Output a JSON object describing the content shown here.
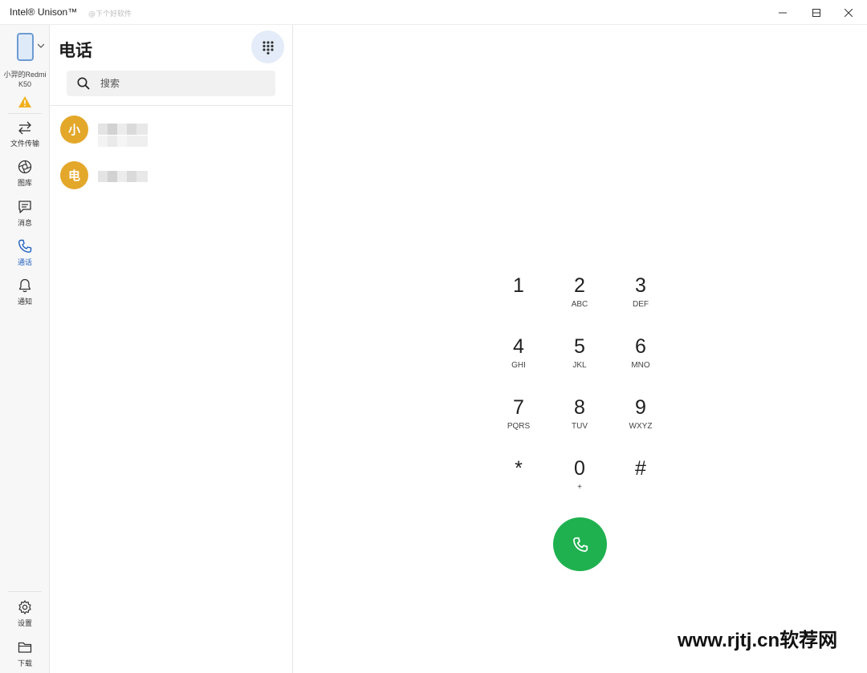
{
  "window": {
    "title": "Intel® Unison™",
    "top_watermark": "@下个好软件",
    "controls": [
      "minimize-icon",
      "maximize-icon",
      "close-icon"
    ]
  },
  "device": {
    "name_line1": "小羿的Redmi",
    "name_line2": "K50",
    "status_icon": "warning-icon"
  },
  "rail": {
    "items": [
      {
        "label": "文件传输",
        "icon": "transfer-icon"
      },
      {
        "label": "图库",
        "icon": "gallery-icon"
      },
      {
        "label": "消息",
        "icon": "message-icon"
      },
      {
        "label": "通话",
        "icon": "phone-icon",
        "active": true
      },
      {
        "label": "通知",
        "icon": "bell-icon"
      }
    ],
    "bottom": [
      {
        "label": "设置",
        "icon": "gear-icon"
      },
      {
        "label": "下载",
        "icon": "folder-icon"
      }
    ]
  },
  "panel": {
    "title": "电话",
    "search_placeholder": "搜索",
    "contacts": [
      {
        "initial": "小"
      },
      {
        "initial": "电"
      }
    ]
  },
  "dialer": {
    "keys": [
      {
        "num": "1",
        "letters": ""
      },
      {
        "num": "2",
        "letters": "ABC"
      },
      {
        "num": "3",
        "letters": "DEF"
      },
      {
        "num": "4",
        "letters": "GHI"
      },
      {
        "num": "5",
        "letters": "JKL"
      },
      {
        "num": "6",
        "letters": "MNO"
      },
      {
        "num": "7",
        "letters": "PQRS"
      },
      {
        "num": "8",
        "letters": "TUV"
      },
      {
        "num": "9",
        "letters": "WXYZ"
      },
      {
        "num": "*",
        "letters": ""
      },
      {
        "num": "0",
        "letters": "+"
      },
      {
        "num": "#",
        "letters": ""
      }
    ],
    "call_icon": "phone-call-icon",
    "call_color": "#1fb14f"
  },
  "site_watermark": "www.rjtj.cn软荐网",
  "colors": {
    "accent": "#1f5fbf",
    "avatar": "#e3a72a",
    "warning": "#f2b01e"
  }
}
